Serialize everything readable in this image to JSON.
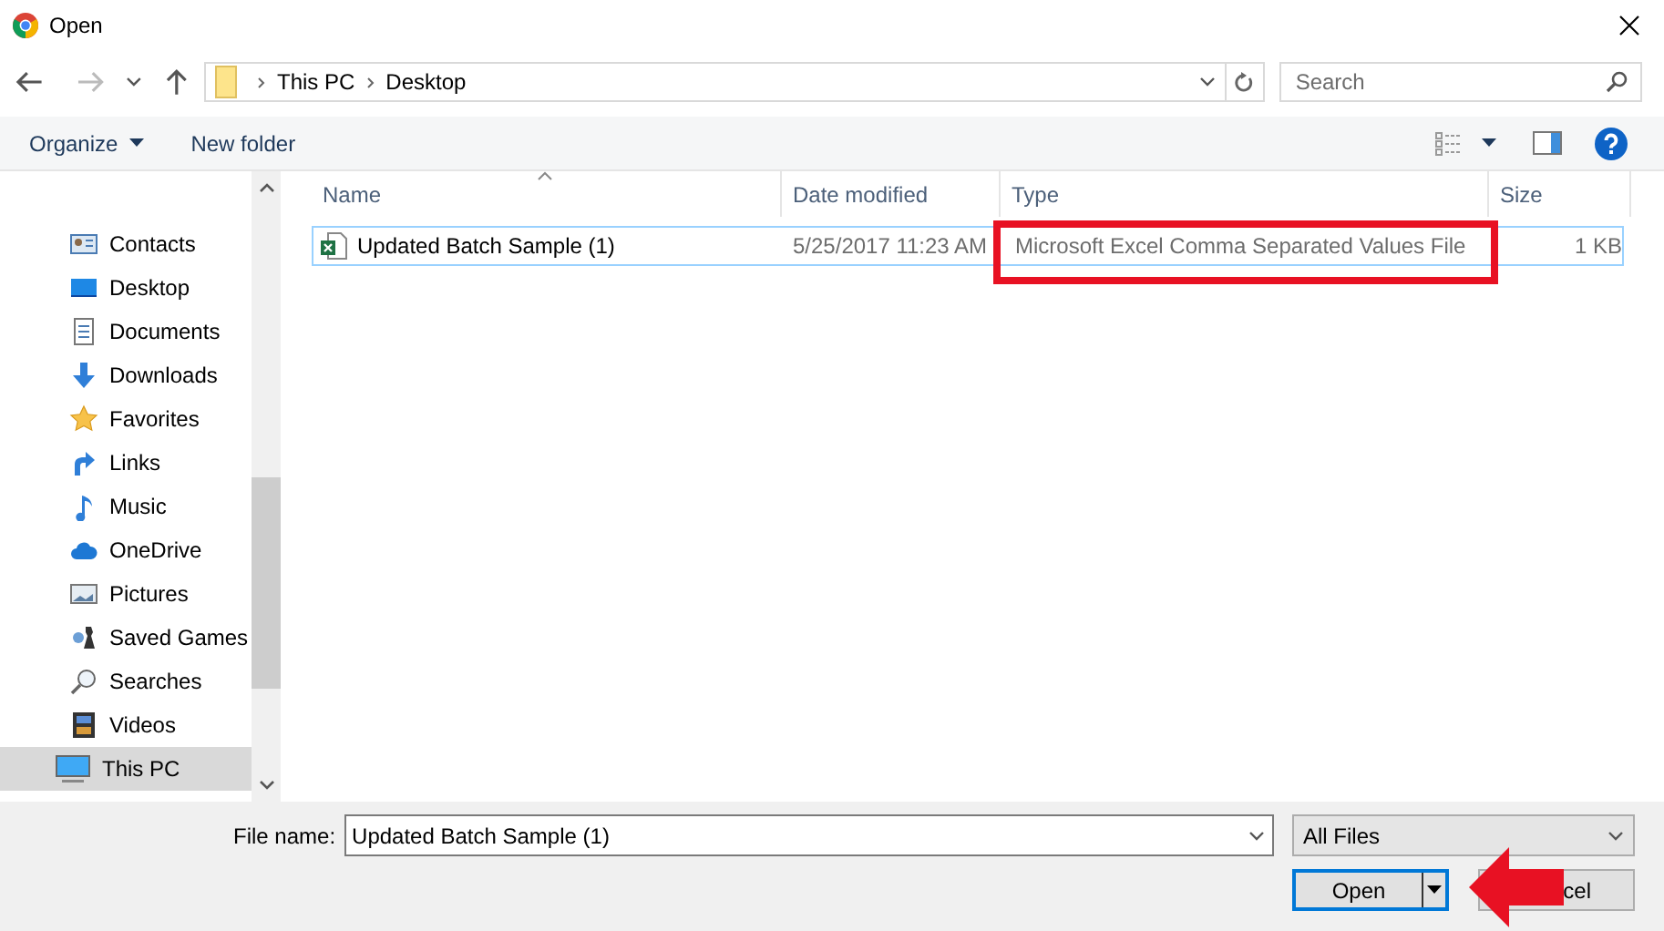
{
  "window": {
    "title": "Open"
  },
  "address": {
    "path": [
      "This PC",
      "Desktop"
    ]
  },
  "search": {
    "placeholder": "Search"
  },
  "toolbar": {
    "organize": "Organize",
    "new_folder": "New folder"
  },
  "sidebar": {
    "items": [
      {
        "label": "Contacts",
        "kind": "contacts",
        "selected": false
      },
      {
        "label": "Desktop",
        "kind": "desktop",
        "selected": false
      },
      {
        "label": "Documents",
        "kind": "documents",
        "selected": false
      },
      {
        "label": "Downloads",
        "kind": "downloads",
        "selected": false
      },
      {
        "label": "Favorites",
        "kind": "favorites",
        "selected": false
      },
      {
        "label": "Links",
        "kind": "links",
        "selected": false
      },
      {
        "label": "Music",
        "kind": "music",
        "selected": false
      },
      {
        "label": "OneDrive",
        "kind": "onedrive",
        "selected": false
      },
      {
        "label": "Pictures",
        "kind": "pictures",
        "selected": false
      },
      {
        "label": "Saved Games",
        "kind": "games",
        "selected": false
      },
      {
        "label": "Searches",
        "kind": "searches",
        "selected": false
      },
      {
        "label": "Videos",
        "kind": "videos",
        "selected": false
      },
      {
        "label": "This PC",
        "kind": "pc",
        "selected": true
      }
    ]
  },
  "table": {
    "columns": [
      "Name",
      "Date modified",
      "Type",
      "Size"
    ],
    "rows": [
      {
        "name": "Updated Batch Sample (1)",
        "date": "5/25/2017 11:23 AM",
        "type": "Microsoft Excel Comma Separated Values File",
        "size": "1 KB",
        "selected": true
      }
    ]
  },
  "bottom": {
    "file_name_label": "File name:",
    "file_name": "Updated Batch Sample (1)",
    "filter": "All Files",
    "open": "Open",
    "cancel": "cel"
  }
}
